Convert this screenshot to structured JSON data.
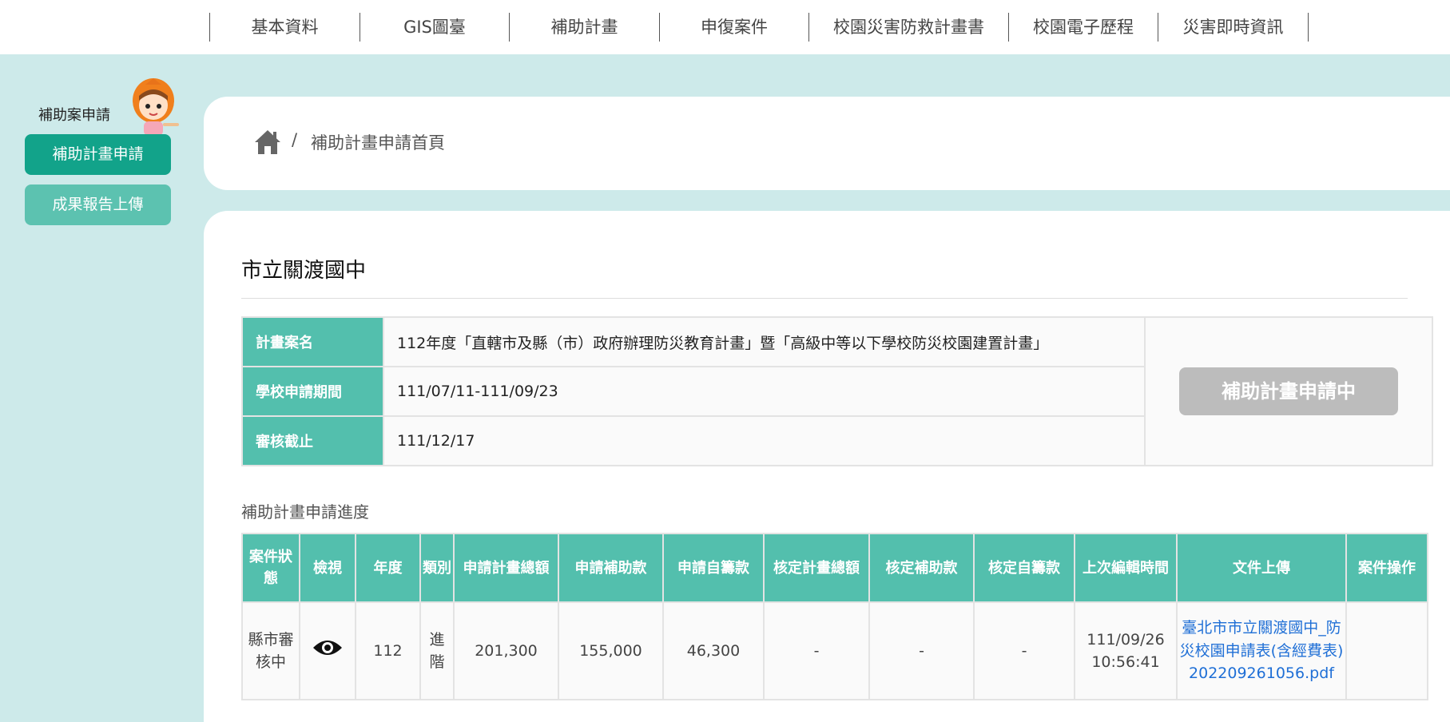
{
  "nav": {
    "items": [
      "基本資料",
      "GIS圖臺",
      "補助計畫",
      "申復案件",
      "校園災害防救計畫書",
      "校園電子歷程",
      "災害即時資訊"
    ]
  },
  "sidebar": {
    "title": "補助案申請",
    "items": [
      {
        "label": "補助計畫申請",
        "active": true
      },
      {
        "label": "成果報告上傳",
        "active": false
      }
    ]
  },
  "breadcrumb": {
    "home_icon": "home-icon",
    "separator": "/",
    "current": "補助計畫申請首頁"
  },
  "school_name": "市立關渡國中",
  "plan_info": {
    "rows": [
      {
        "key": "計畫案名",
        "value": "112年度「直轄市及縣（市）政府辦理防災教育計畫」暨「高級中等以下學校防災校園建置計畫」"
      },
      {
        "key": "學校申請期間",
        "value": "111/07/11-111/09/23"
      },
      {
        "key": "審核截止",
        "value": "111/12/17"
      }
    ],
    "action_label": "補助計畫申請中"
  },
  "progress": {
    "title": "補助計畫申請進度",
    "headers": [
      "案件狀態",
      "檢視",
      "年度",
      "類別",
      "申請計畫總額",
      "申請補助款",
      "申請自籌款",
      "核定計畫總額",
      "核定補助款",
      "核定自籌款",
      "上次編輯時間",
      "文件上傳",
      "案件操作"
    ],
    "row": {
      "status": "縣市審核中",
      "view_icon": "eye-icon",
      "year": "112",
      "category": "進階",
      "total": "201,300",
      "subsidy": "155,000",
      "self_fund": "46,300",
      "approved_total": "-",
      "approved_subsidy": "-",
      "approved_self": "-",
      "last_edit": "111/09/26 10:56:41",
      "file": "臺北市市立關渡國中_防災校園申請表(含經費表)202209261056.pdf",
      "operation": ""
    }
  },
  "colors": {
    "accent": "#53bfad",
    "active_button": "#12a38a",
    "page_bg": "#cdeaea",
    "disabled_button": "#bcbcbc"
  }
}
